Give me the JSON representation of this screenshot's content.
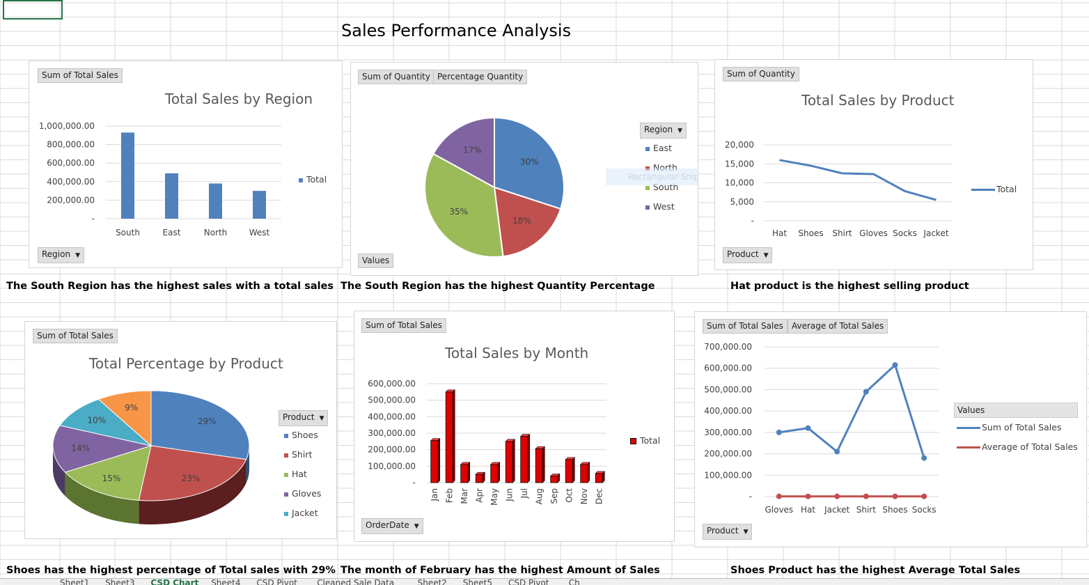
{
  "title": "Sales Performance Analysis",
  "tabs": [
    "Sheet1",
    "Sheet3",
    "CSD Chart",
    "Sheet4",
    "CSD Pivot",
    "Cleaned Sale Data",
    "Sheet2",
    "Sheet5",
    "CSD Pivot",
    "Ch"
  ],
  "captions": {
    "region": "The South Region has the highest  sales with a total sales",
    "quantity": "The South Region  has the highest Quantity Percentage",
    "product": "Hat product is the highest selling product",
    "percentage": "Shoes has the highest percentage of Total sales with 29%",
    "month": "The month of February has the highest Amount of Sales",
    "average": "Shoes Product  has the highest Average Total Sales"
  },
  "charts": {
    "region": {
      "field_value": "Sum of Total Sales",
      "field_axis": "Region",
      "title": "Total Sales by Region",
      "legend": "Total"
    },
    "quantity": {
      "field_value_1": "Sum of Quantity",
      "field_value_2": "Percentage Quantity",
      "field_values": "Values",
      "field_legend": "Region",
      "legend": [
        "East",
        "North",
        "South",
        "West"
      ],
      "ghost": "Rectangular Snip"
    },
    "product": {
      "field_value": "Sum of Quantity",
      "field_axis": "Product",
      "title": "Total Sales by Product",
      "legend": "Total"
    },
    "percentage": {
      "field_value": "Sum of Total Sales",
      "field_legend": "Product",
      "title": "Total Percentage by Product",
      "legend": [
        "Shoes",
        "Shirt",
        "Hat",
        "Gloves",
        "Jacket"
      ]
    },
    "month": {
      "field_value": "Sum of Total Sales",
      "field_axis": "OrderDate",
      "title": "Total Sales by Month",
      "legend": "Total"
    },
    "average": {
      "field_value_1": "Sum of Total Sales",
      "field_value_2": "Average of Total Sales",
      "field_axis": "Product",
      "legend_title": "Values",
      "legend": [
        "Sum of Total Sales",
        "Average of Total Sales"
      ]
    }
  },
  "colors": {
    "blue": "#4f81bd",
    "red": "#c0504d",
    "green": "#9bbb59",
    "purple": "#8064a2",
    "teal": "#4bacc6",
    "orange": "#f79646",
    "bar_red": "#e00000",
    "excel_green": "#217346"
  },
  "chart_data": [
    {
      "id": "region",
      "type": "bar",
      "title": "Total Sales by Region",
      "categories": [
        "South",
        "East",
        "North",
        "West"
      ],
      "series": [
        {
          "name": "Total",
          "values": [
            930000,
            490000,
            380000,
            300000
          ]
        }
      ],
      "ylim": [
        0,
        1000000
      ],
      "yticks": [
        0,
        200000,
        400000,
        600000,
        800000,
        1000000
      ],
      "ytick_labels": [
        "-",
        "200,000.00",
        "400,000.00",
        "600,000.00",
        "800,000.00",
        "1,000,000.00"
      ],
      "grid": true,
      "legend": "right"
    },
    {
      "id": "quantity",
      "type": "pie",
      "categories": [
        "East",
        "North",
        "South",
        "West"
      ],
      "values": [
        30,
        18,
        35,
        17
      ],
      "labels": [
        "30%",
        "18%",
        "35%",
        "17%"
      ],
      "legend": "right"
    },
    {
      "id": "product",
      "type": "line",
      "title": "Total Sales by Product",
      "categories": [
        "Hat",
        "Shoes",
        "Shirt",
        "Gloves",
        "Socks",
        "Jacket"
      ],
      "series": [
        {
          "name": "Total",
          "values": [
            16000,
            14500,
            12500,
            12300,
            7800,
            5500
          ]
        }
      ],
      "ylim": [
        0,
        20000
      ],
      "yticks": [
        0,
        5000,
        10000,
        15000,
        20000
      ],
      "ytick_labels": [
        "-",
        "5,000",
        "10,000",
        "15,000",
        "20,000"
      ],
      "grid": true,
      "legend": "right"
    },
    {
      "id": "percentage",
      "type": "pie",
      "title": "Total Percentage by Product",
      "categories": [
        "Shoes",
        "Shirt",
        "Hat",
        "Gloves",
        "Jacket"
      ],
      "values": [
        29,
        23,
        15,
        14,
        10,
        9
      ],
      "slice_names": [
        "Shoes",
        "Shirt",
        "Hat",
        "Gloves",
        "Jacket",
        ""
      ],
      "labels": [
        "29%",
        "23%",
        "15%",
        "14%",
        "10%",
        "9%"
      ],
      "legend": "right"
    },
    {
      "id": "month",
      "type": "bar",
      "title": "Total Sales by Month",
      "categories": [
        "Jan",
        "Feb",
        "Mar",
        "Apr",
        "May",
        "Jun",
        "Jul",
        "Aug",
        "Sep",
        "Oct",
        "Nov",
        "Dec"
      ],
      "series": [
        {
          "name": "Total",
          "values": [
            255000,
            550000,
            110000,
            50000,
            110000,
            250000,
            280000,
            205000,
            40000,
            140000,
            110000,
            55000
          ]
        }
      ],
      "ylim": [
        0,
        600000
      ],
      "yticks": [
        0,
        100000,
        200000,
        300000,
        400000,
        500000,
        600000
      ],
      "ytick_labels": [
        "-",
        "100,000.00",
        "200,000.00",
        "300,000.00",
        "400,000.00",
        "500,000.00",
        "600,000.00"
      ],
      "grid": true,
      "legend": "right"
    },
    {
      "id": "average",
      "type": "line",
      "categories": [
        "Gloves",
        "Hat",
        "Jacket",
        "Shirt",
        "Shoes",
        "Socks"
      ],
      "series": [
        {
          "name": "Sum of Total Sales",
          "values": [
            300000,
            320000,
            210000,
            490000,
            615000,
            180000
          ]
        },
        {
          "name": "Average of Total Sales",
          "values": [
            1000,
            1000,
            1000,
            1000,
            1000,
            1000
          ]
        }
      ],
      "ylim": [
        0,
        700000
      ],
      "yticks": [
        0,
        100000,
        200000,
        300000,
        400000,
        500000,
        600000,
        700000
      ],
      "ytick_labels": [
        "-",
        "100,000.00",
        "200,000.00",
        "300,000.00",
        "400,000.00",
        "500,000.00",
        "600,000.00",
        "700,000.00"
      ],
      "grid": true,
      "legend": "right"
    }
  ]
}
